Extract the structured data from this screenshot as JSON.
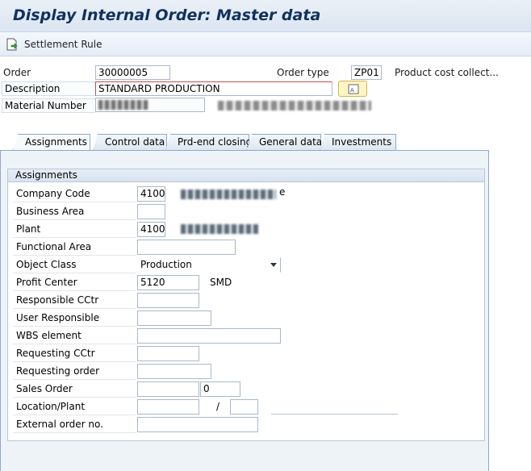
{
  "window": {
    "title": "Display Internal Order: Master data"
  },
  "toolbar": {
    "settlement_rule": "Settlement Rule"
  },
  "header": {
    "order_label": "Order",
    "order_value": "30000005",
    "order_type_label": "Order type",
    "order_type_value": "ZP01",
    "order_type_text": "Product cost collect...",
    "description_label": "Description",
    "description_value": "STANDARD PRODUCTION",
    "material_label": "Material Number"
  },
  "tabs": [
    {
      "label": "Assignments"
    },
    {
      "label": "Control data"
    },
    {
      "label": "Prd-end closing"
    },
    {
      "label": "General data"
    },
    {
      "label": "Investments"
    }
  ],
  "assignments": {
    "group_title": "Assignments",
    "company_code_label": "Company Code",
    "company_code_value": "4100",
    "company_code_text_suffix": "e",
    "business_area_label": "Business Area",
    "plant_label": "Plant",
    "plant_value": "4100",
    "functional_area_label": "Functional Area",
    "object_class_label": "Object Class",
    "object_class_value": "Production",
    "profit_center_label": "Profit Center",
    "profit_center_value": "5120",
    "profit_center_text": "SMD",
    "responsible_cctr_label": "Responsible CCtr",
    "user_responsible_label": "User Responsible",
    "wbs_label": "WBS element",
    "requesting_cctr_label": "Requesting CCtr",
    "requesting_order_label": "Requesting order",
    "sales_order_label": "Sales Order",
    "sales_order_item": "0",
    "location_plant_label": "Location/Plant",
    "location_sep": "/",
    "external_order_label": "External order no."
  },
  "colors": {
    "title": "#10315e",
    "tab_border": "#8fa9c9",
    "panel_bg": "#eef3f8"
  }
}
